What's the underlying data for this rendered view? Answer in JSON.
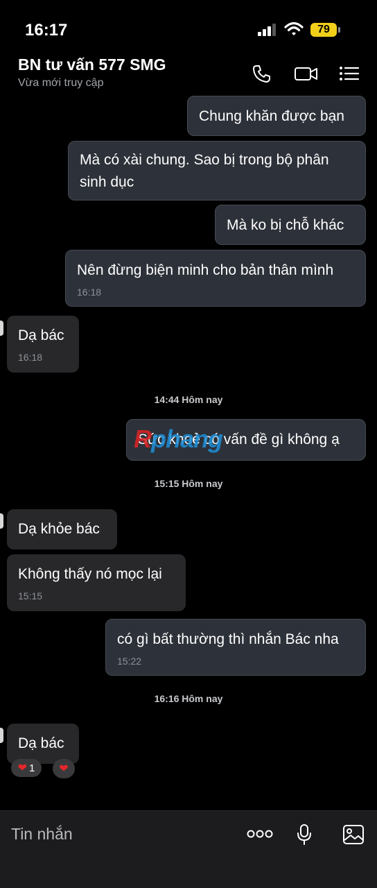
{
  "status_bar": {
    "time": "16:17",
    "battery": "79",
    "signal_icon": "cellular-signal-icon",
    "wifi_icon": "wifi-icon"
  },
  "header": {
    "title": "BN tư vấn 577 SMG",
    "subtitle": "Vừa mới truy cập",
    "icons": [
      "phone-icon",
      "video-call-icon",
      "menu-list-icon"
    ]
  },
  "messages": [
    {
      "dir": "out",
      "text": "Chung khăn được bạn"
    },
    {
      "dir": "out",
      "text": "Mà có xài chung. Sao bị trong bộ phân sinh dục"
    },
    {
      "dir": "out",
      "text": "Mà ko bị chỗ khác"
    },
    {
      "dir": "out",
      "text": "Nên đừng biện minh cho bản thân mình",
      "time": "16:18"
    },
    {
      "dir": "in",
      "text": "Dạ bác",
      "time": "16:18"
    },
    {
      "dir": "out",
      "text": "Sức khoẻ có vấn đề gì không ạ"
    },
    {
      "dir": "in",
      "text": "Dạ khỏe bác"
    },
    {
      "dir": "in",
      "text": "Không thấy nó mọc lại",
      "time": "15:15"
    },
    {
      "dir": "out",
      "text": "có gì bất thường thì nhắn Bác nha",
      "time": "15:22"
    },
    {
      "dir": "in",
      "text": "Dạ bác"
    }
  ],
  "separators": [
    "14:44 Hôm nay",
    "15:15 Hôm nay",
    "16:16 Hôm nay"
  ],
  "reactions": {
    "count": "1",
    "heart_icon": "heart-icon"
  },
  "watermark": {
    "part1": "R",
    "part2": "phang"
  },
  "input": {
    "placeholder": "Tin nhắn",
    "icons": [
      "more-dots-icon",
      "microphone-icon",
      "image-icon"
    ]
  },
  "colors": {
    "accent_battery": "#f2d01a",
    "heart": "#e8262b",
    "bubble_out": "#2d3139",
    "bubble_in": "#28282a"
  }
}
